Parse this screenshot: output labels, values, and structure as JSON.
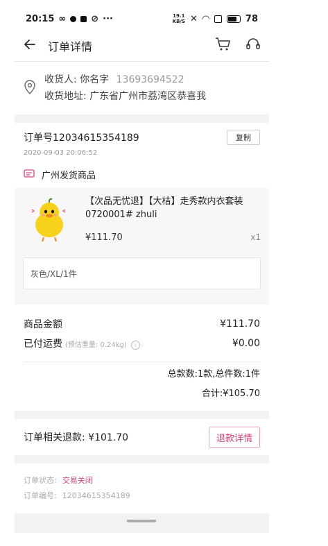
{
  "status_bar": {
    "time": "20:15",
    "net_speed": "19.1",
    "battery": "78"
  },
  "navbar": {
    "title": "订单详情"
  },
  "address": {
    "receiver_label": "收货人:",
    "receiver_name": "你名字",
    "phone": "13693694522",
    "address_label": "收货地址:",
    "address": "广东省广州市荔湾区恭喜我"
  },
  "order": {
    "order_no": "订单号12034615354189",
    "copy_label": "复制",
    "created_at": "2020-09-03 20:06:52",
    "ship_from": "广州发货商品"
  },
  "goods": {
    "title": "【次品无忧退】【大桔】走秀款内衣套装 0720001# zhuli",
    "price": "¥111.70",
    "qty": "x1",
    "sku": "灰色/XL/1件"
  },
  "summary": {
    "goods_amount_label": "商品金额",
    "goods_amount": "¥111.70",
    "freight_label": "已付运费",
    "weight_note": "(预估重量: 0.24kg)",
    "freight": "¥0.00",
    "count_text": "总款数:1款,总件数:1件",
    "total_text": "合计:¥105.70"
  },
  "refund": {
    "label": "订单相关退款: ¥101.70",
    "button": "退款详情"
  },
  "order_status": {
    "status_label": "订单状态:",
    "status_value": "交易关闭",
    "no_label": "订单编号:",
    "no_value": "12034615354189"
  },
  "colors": {
    "accent": "#d9417a"
  }
}
